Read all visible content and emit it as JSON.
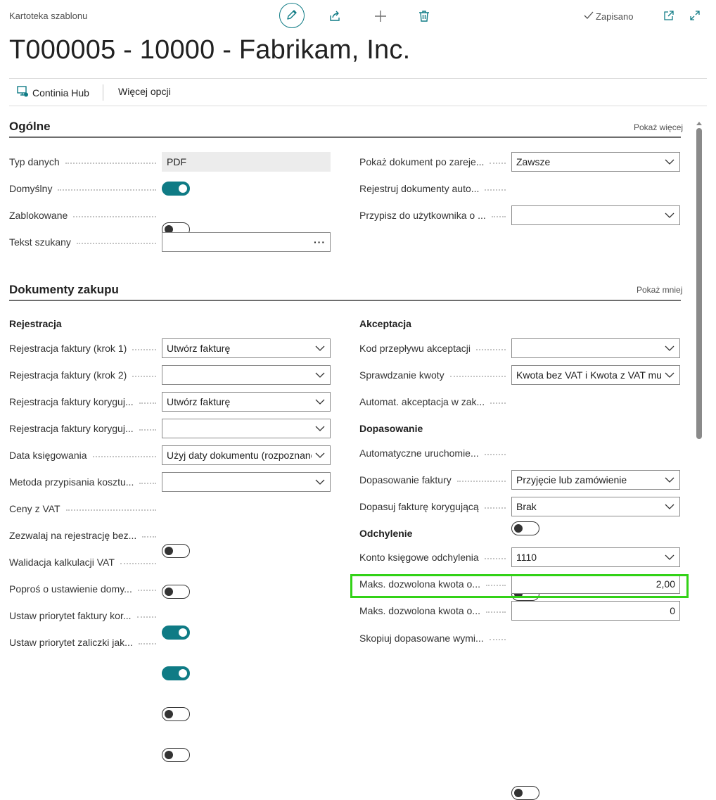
{
  "header": {
    "caption": "Kartoteka szablonu",
    "saved_label": "Zapisano",
    "title": "T000005 - 10000 - Fabrikam, Inc.",
    "icons": [
      "pencil-icon",
      "share-icon",
      "plus-icon",
      "trash-icon",
      "check-icon",
      "popout-icon",
      "expand-icon"
    ]
  },
  "actionbar": {
    "continia_hub": "Continia Hub",
    "more_options": "Więcej opcji"
  },
  "general": {
    "title": "Ogólne",
    "toggle_link": "Pokaż więcej",
    "left": [
      {
        "label": "Typ danych",
        "type": "readonly",
        "value": "PDF"
      },
      {
        "label": "Domyślny",
        "type": "toggle",
        "on": true
      },
      {
        "label": "Zablokowane",
        "type": "toggle",
        "on": false
      },
      {
        "label": "Tekst szukany",
        "type": "lookup",
        "value": "",
        "button": "···"
      }
    ],
    "right": [
      {
        "label": "Pokaż dokument po zareje...",
        "type": "select",
        "value": "Zawsze"
      },
      {
        "label": "Rejestruj dokumenty auto...",
        "type": "toggle",
        "on": false
      },
      {
        "label": "Przypisz do użytkownika o ...",
        "type": "select",
        "value": ""
      }
    ]
  },
  "purchase": {
    "title": "Dokumenty zakupu",
    "toggle_link": "Pokaż mniej",
    "left_group": "Rejestracja",
    "left": [
      {
        "label": "Rejestracja faktury (krok 1)",
        "type": "select",
        "value": "Utwórz fakturę"
      },
      {
        "label": "Rejestracja faktury (krok 2)",
        "type": "select",
        "value": ""
      },
      {
        "label": "Rejestracja faktury koryguj...",
        "type": "select",
        "value": "Utwórz fakturę"
      },
      {
        "label": "Rejestracja faktury koryguj...",
        "type": "select",
        "value": ""
      },
      {
        "label": "Data księgowania",
        "type": "select",
        "value": "Użyj daty dokumentu (rozpoznane)"
      },
      {
        "label": "Metoda przypisania kosztu...",
        "type": "select",
        "value": ""
      },
      {
        "label": "Ceny z VAT",
        "type": "toggle",
        "on": false
      },
      {
        "label": "Zezwalaj na rejestrację bez...",
        "type": "toggle",
        "on": false
      },
      {
        "label": "Walidacja kalkulacji VAT",
        "type": "toggle",
        "on": true
      },
      {
        "label": "Poproś o ustawienie domy...",
        "type": "toggle",
        "on": true
      },
      {
        "label": "Ustaw priorytet faktury kor...",
        "type": "toggle",
        "on": false
      },
      {
        "label": "Ustaw priorytet zaliczki jak...",
        "type": "toggle",
        "on": false
      }
    ],
    "right_groups": {
      "acceptance": "Akceptacja",
      "matching": "Dopasowanie",
      "variance": "Odchylenie"
    },
    "acceptance": [
      {
        "label": "Kod przepływu akceptacji",
        "type": "select",
        "value": ""
      },
      {
        "label": "Sprawdzanie kwoty",
        "type": "select",
        "value": "Kwota bez VAT i Kwota z VAT musza"
      },
      {
        "label": "Automat. akceptacja w zak...",
        "type": "toggle",
        "on": false
      }
    ],
    "matching": [
      {
        "label": "Automatyczne uruchomie...",
        "type": "toggle",
        "on": false
      },
      {
        "label": "Dopasowanie faktury",
        "type": "select",
        "value": "Przyjęcie lub zamówienie"
      },
      {
        "label": "Dopasuj fakturę korygującą",
        "type": "select",
        "value": "Brak"
      }
    ],
    "variance": [
      {
        "label": "Konto księgowe odchylenia",
        "type": "select",
        "value": "1110"
      },
      {
        "label": "Maks. dozwolona kwota o...",
        "type": "number",
        "value": "2,00"
      },
      {
        "label": "Maks. dozwolona kwota o...",
        "type": "number",
        "value": "0"
      },
      {
        "label": "Skopiuj dopasowane wymi...",
        "type": "toggle",
        "on": false
      }
    ]
  },
  "colors": {
    "accent": "#0f7b85",
    "highlight": "#32d217"
  }
}
